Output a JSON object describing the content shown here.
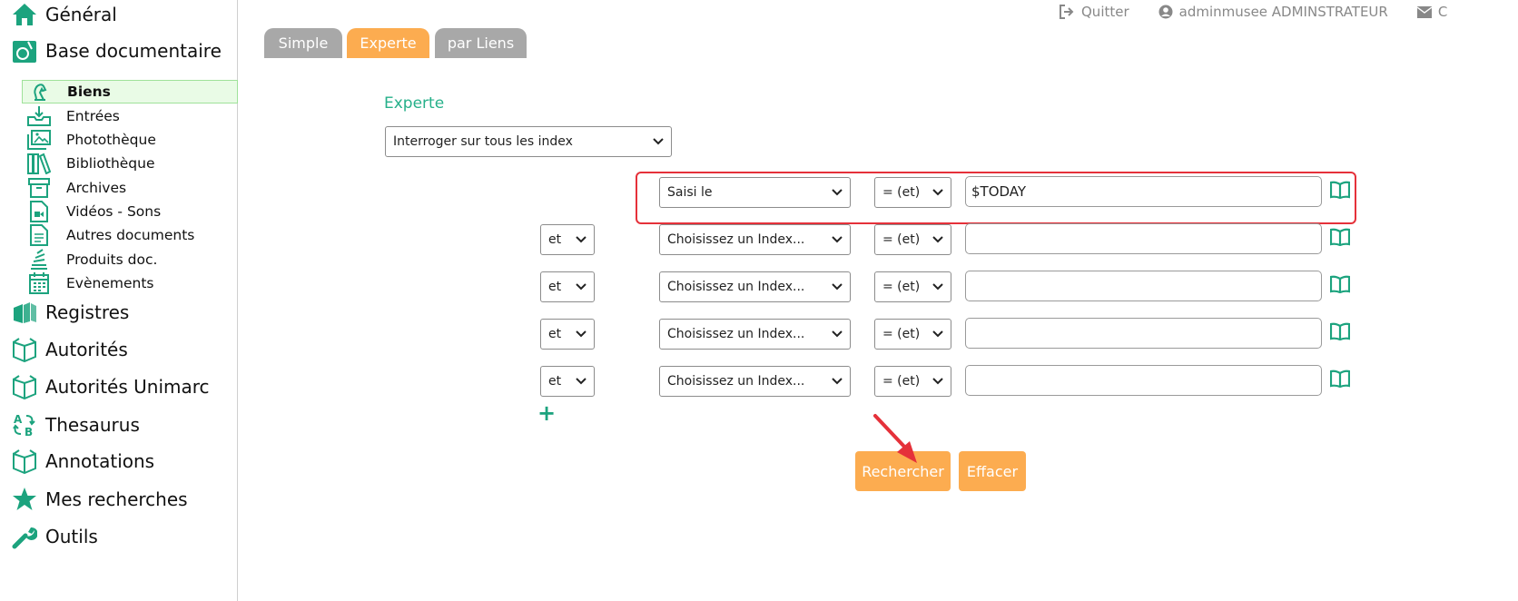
{
  "sidebar": {
    "main_top": [
      {
        "label": "Général",
        "icon": "home-icon"
      },
      {
        "label": "Base documentaire",
        "icon": "database-icon"
      }
    ],
    "sub_items": [
      {
        "label": "Biens",
        "icon": "chess-knight-icon",
        "active": true
      },
      {
        "label": "Entrées",
        "icon": "inbox-download-icon"
      },
      {
        "label": "Photothèque",
        "icon": "images-icon"
      },
      {
        "label": "Bibliothèque",
        "icon": "books-icon"
      },
      {
        "label": "Archives",
        "icon": "archive-box-icon"
      },
      {
        "label": "Vidéos - Sons",
        "icon": "video-file-icon"
      },
      {
        "label": "Autres documents",
        "icon": "document-icon"
      },
      {
        "label": "Produits doc.",
        "icon": "stack-icon"
      },
      {
        "label": "Evènements",
        "icon": "calendar-icon"
      }
    ],
    "main_bottom": [
      {
        "label": "Registres",
        "icon": "registers-icon"
      },
      {
        "label": "Autorités",
        "icon": "open-box-icon"
      },
      {
        "label": "Autorités Unimarc",
        "icon": "open-box-icon"
      },
      {
        "label": "Thesaurus",
        "icon": "thesaurus-icon"
      },
      {
        "label": "Annotations",
        "icon": "open-box-icon"
      },
      {
        "label": "Mes recherches",
        "icon": "star-icon"
      },
      {
        "label": "Outils",
        "icon": "wrench-icon"
      }
    ]
  },
  "topbar": {
    "quit_label": "Quitter",
    "user_label": "adminmusee ADMINSTRATEUR",
    "mail_label": "C"
  },
  "tabs": [
    {
      "label": "Simple"
    },
    {
      "label": "Experte"
    },
    {
      "label": "par Liens"
    }
  ],
  "active_tab": "Experte",
  "form": {
    "title": "Experte",
    "scope_select": "Interroger sur tous les index",
    "rows": [
      {
        "connector": "",
        "index": "Saisi le",
        "operator": "= (et)",
        "value": "$TODAY"
      },
      {
        "connector": "et",
        "index": "Choisissez un Index...",
        "operator": "= (et)",
        "value": ""
      },
      {
        "connector": "et",
        "index": "Choisissez un Index...",
        "operator": "= (et)",
        "value": ""
      },
      {
        "connector": "et",
        "index": "Choisissez un Index...",
        "operator": "= (et)",
        "value": ""
      },
      {
        "connector": "et",
        "index": "Choisissez un Index...",
        "operator": "= (et)",
        "value": ""
      }
    ],
    "add_label": "+",
    "search_label": "Rechercher",
    "clear_label": "Effacer"
  },
  "colors": {
    "accent_green": "#1ca37e",
    "orange": "#fcac50",
    "tab_gray": "#a8a8a8",
    "highlight_red": "#e5313a"
  }
}
